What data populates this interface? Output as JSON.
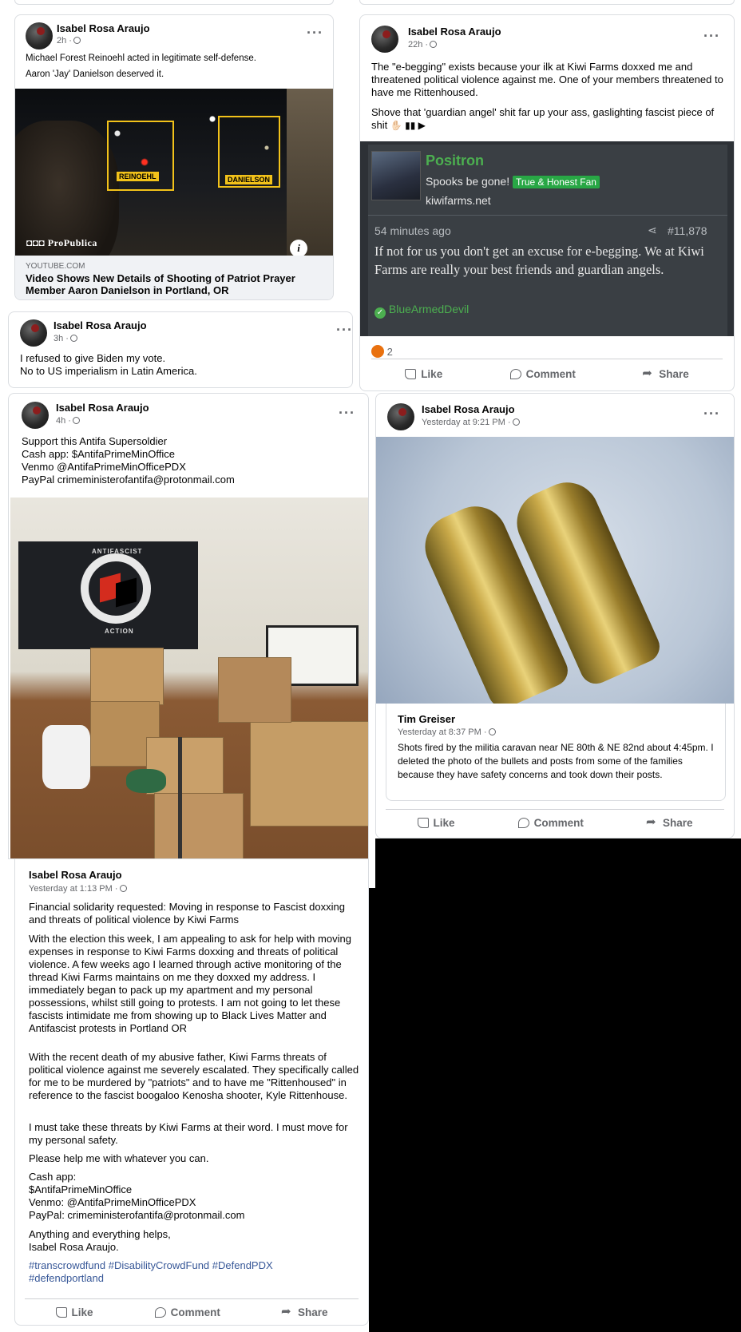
{
  "post1": {
    "author": "Isabel Rosa Araujo",
    "time": "2h ·",
    "lines": [
      "Michael Forest Reinoehl acted in legitimate self-defense.",
      "Aaron 'Jay' Danielson deserved it."
    ],
    "video_labels": [
      "REINOEHL",
      "DANIELSON"
    ],
    "watermark": "ProPublica",
    "link_source": "YOUTUBE.COM",
    "link_title": "Video Shows New Details of Shooting of Patriot Prayer Member Aaron Danielson in Portland, OR"
  },
  "post2": {
    "author": "Isabel Rosa Araujo",
    "time": "22h ·",
    "text1": "The \"e-begging\" exists because your ilk at Kiwi Farms doxxed me and threatened political violence against me. One of your members threatened to have me Rittenhoused.",
    "text2": "Shove that 'guardian angel' shit far up your ass, gaslighting fascist piece of shit",
    "quote": {
      "user": "Positron",
      "tagline": "Spooks be gone!",
      "badge": "True & Honest Fan",
      "site": "kiwifarms.net",
      "age": "54 minutes ago",
      "post_no": "#11,878",
      "body": "If not for us you don't get an excuse for e-begging. We at Kiwi Farms are really your best friends and guardian angels.",
      "reactor": "BlueArmedDevil"
    },
    "reactions": "2",
    "actions": [
      "Like",
      "Comment",
      "Share"
    ]
  },
  "post3": {
    "author": "Isabel Rosa Araujo",
    "time": "3h ·",
    "text": "I refused to give Biden my vote.\nNo to US imperialism in Latin America."
  },
  "post4": {
    "author": "Isabel Rosa Araujo",
    "time": "4h ·",
    "text": "Support this Antifa Supersoldier\nCash app: $AntifaPrimeMinOffice\nVenmo @AntifaPrimeMinOfficePDX\nPayPal crimeministerofantifa@protonmail.com",
    "flag_text_top": "ANTIFASCIST",
    "flag_text_bottom": "ACTION"
  },
  "post5": {
    "author": "Isabel Rosa Araujo",
    "time": "Yesterday at 9:21 PM ·",
    "shared_author": "Tim Greiser",
    "shared_time": "Yesterday at 8:37 PM ·",
    "shared_text": "Shots fired by the militia caravan near NE 80th & NE 82nd about 4:45pm. I deleted the photo of the bullets and posts from some of the families because they have safety concerns and took down their posts.",
    "actions": [
      "Like",
      "Comment",
      "Share"
    ]
  },
  "post6": {
    "author": "Isabel Rosa Araujo",
    "time": "Yesterday at 1:13 PM ·",
    "p1": "Financial solidarity requested: Moving in response to Fascist doxxing and threats of political violence by Kiwi Farms",
    "p2": "With the election this week, I am appealing to ask for help with moving expenses in response to Kiwi Farms doxxing and threats of political violence. A few weeks ago I learned through active monitoring of the thread Kiwi Farms maintains on me they doxxed my address. I immediately began to pack up my apartment and my personal possessions, whilst still going to protests. I am not going to let these fascists intimidate me from showing up to Black Lives Matter and Antifascist protests in Portland OR",
    "p3": "With the recent death of my abusive father, Kiwi Farms threats of political violence against me severely escalated. They specifically called for me to be murdered by \"patriots\" and to have me \"Rittenhoused\" in reference to the fascist boogaloo Kenosha shooter, Kyle Rittenhouse.",
    "p4": "I must take these threats by Kiwi Farms at their word. I must move for my personal safety.",
    "p5": "Please help me with whatever you can.",
    "p6": "Cash app:\n$AntifaPrimeMinOffice\nVenmo: @AntifaPrimeMinOfficePDX\nPayPal: crimeministerofantifa@protonmail.com",
    "p7": "Anything and everything helps,\nIsabel Rosa Araujo.",
    "hashtags": "#transcrowdfund #DisabilityCrowdFund #DefendPDX #defendportland",
    "actions": [
      "Like",
      "Comment",
      "Share"
    ]
  },
  "colors": {
    "like_blue": "#1877f2",
    "text_gray": "#65676b",
    "kf_dark": "#3a3f44",
    "kf_green": "#4caf50"
  }
}
